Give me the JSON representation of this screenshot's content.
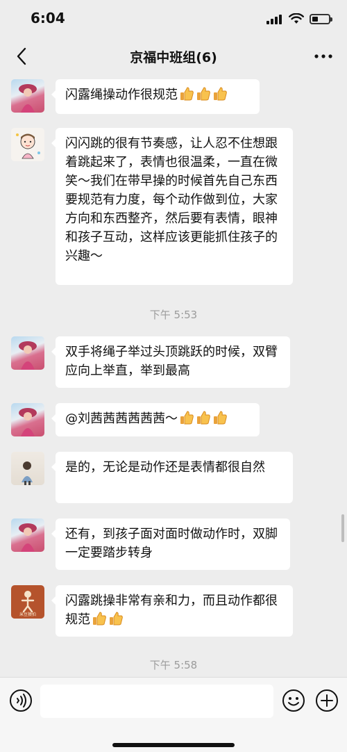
{
  "status_bar": {
    "time": "6:04"
  },
  "nav": {
    "title": "京福中班组(6)"
  },
  "messages": [
    {
      "text": "闪露绳操动作很规范",
      "thumbs": 3
    },
    {
      "text": "闪闪跳的很有节奏感，让人忍不住想跟着跳起来了，表情也很温柔，一直在微笑～我们在带早操的时候首先自己东西要规范有力度，每个动作做到位，大家方向和东西整齐，然后要有表情，眼神和孩子互动，这样应该更能抓住孩子的兴趣～",
      "thumbs": 0
    },
    {
      "text": "双手将绳子举过头顶跳跃的时候，双臂应向上举直，举到最高",
      "thumbs": 0
    },
    {
      "text": "@刘茜茜茜茜茜茜～",
      "thumbs": 3
    },
    {
      "text": "是的，无论是动作还是表情都很自然",
      "thumbs": 0
    },
    {
      "text": "还有，到孩子面对面时做动作时，双脚一定要踏步转身",
      "thumbs": 0
    },
    {
      "text": "闪露跳操非常有亲和力，而且动作都很规范",
      "thumbs": 2
    }
  ],
  "time_dividers": [
    "下午 5:53",
    "下午 5:58"
  ],
  "avatar_labels": {
    "orange_caption": "米豆猿拍"
  },
  "input_bar": {
    "placeholder": ""
  },
  "colors": {
    "background": "#ededed",
    "bubble": "#ffffff",
    "divider_text": "#9b9b9b"
  }
}
